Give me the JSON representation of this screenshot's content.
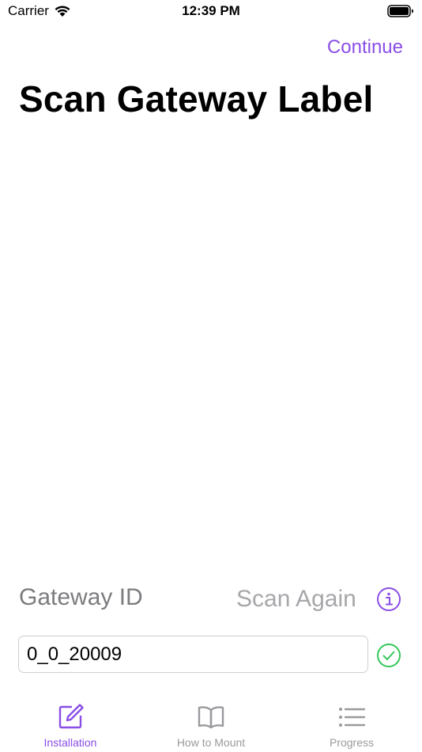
{
  "status_bar": {
    "carrier": "Carrier",
    "time": "12:39 PM"
  },
  "nav": {
    "continue_label": "Continue"
  },
  "page": {
    "title": "Scan Gateway Label"
  },
  "gateway": {
    "label": "Gateway ID",
    "scan_again_label": "Scan Again",
    "id_value": "0_0_20009"
  },
  "tabs": [
    {
      "label": "Installation",
      "icon": "edit-square-icon",
      "active": true
    },
    {
      "label": "How to Mount",
      "icon": "book-icon",
      "active": false
    },
    {
      "label": "Progress",
      "icon": "list-icon",
      "active": false
    }
  ],
  "colors": {
    "accent": "#8a4ee6",
    "success": "#34c759",
    "inactive": "#9a9a9e"
  }
}
